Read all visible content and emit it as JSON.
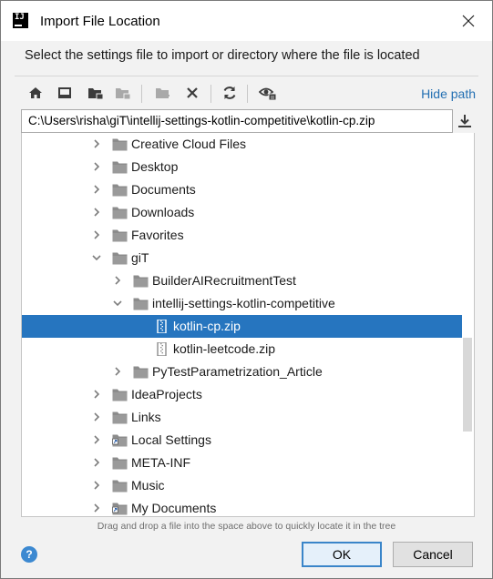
{
  "window": {
    "title": "Import File Location"
  },
  "instruction": "Select the settings file to import or directory where the file is located",
  "toolbar": {
    "buttons": [
      "home-icon",
      "desktop-icon",
      "project-folder-icon",
      "module-folder-icon",
      "new-folder-icon",
      "delete-icon",
      "refresh-icon",
      "show-hidden-icon"
    ],
    "hide_path_label": "Hide path"
  },
  "path_field": {
    "value": "C:\\Users\\risha\\giT\\intellij-settings-kotlin-competitive\\kotlin-cp.zip"
  },
  "tree": {
    "items": [
      {
        "label": "Creative Cloud Files",
        "level": 0,
        "expand": "collapsed",
        "icon": "folder"
      },
      {
        "label": "Desktop",
        "level": 0,
        "expand": "collapsed",
        "icon": "folder"
      },
      {
        "label": "Documents",
        "level": 0,
        "expand": "collapsed",
        "icon": "folder"
      },
      {
        "label": "Downloads",
        "level": 0,
        "expand": "collapsed",
        "icon": "folder"
      },
      {
        "label": "Favorites",
        "level": 0,
        "expand": "collapsed",
        "icon": "folder"
      },
      {
        "label": "giT",
        "level": 0,
        "expand": "expanded",
        "icon": "folder"
      },
      {
        "label": "BuilderAIRecruitmentTest",
        "level": 1,
        "expand": "collapsed",
        "icon": "folder"
      },
      {
        "label": "intellij-settings-kotlin-competitive",
        "level": 1,
        "expand": "expanded",
        "icon": "folder"
      },
      {
        "label": "kotlin-cp.zip",
        "level": 2,
        "expand": "none",
        "icon": "zip",
        "selected": true
      },
      {
        "label": "kotlin-leetcode.zip",
        "level": 2,
        "expand": "none",
        "icon": "zip"
      },
      {
        "label": "PyTestParametrization_Article",
        "level": 1,
        "expand": "collapsed",
        "icon": "folder"
      },
      {
        "label": "IdeaProjects",
        "level": 0,
        "expand": "collapsed",
        "icon": "folder"
      },
      {
        "label": "Links",
        "level": 0,
        "expand": "collapsed",
        "icon": "folder"
      },
      {
        "label": "Local Settings",
        "level": 0,
        "expand": "collapsed",
        "icon": "folder-link"
      },
      {
        "label": "META-INF",
        "level": 0,
        "expand": "collapsed",
        "icon": "folder"
      },
      {
        "label": "Music",
        "level": 0,
        "expand": "collapsed",
        "icon": "folder"
      },
      {
        "label": "My Documents",
        "level": 0,
        "expand": "collapsed",
        "icon": "folder-link"
      }
    ]
  },
  "hint": "Drag and drop a file into the space above to quickly locate it in the tree",
  "buttons": {
    "help": "?",
    "ok": "OK",
    "cancel": "Cancel"
  },
  "colors": {
    "selection": "#2675bf",
    "link": "#2470b3",
    "folder": "#8c8c8c"
  }
}
